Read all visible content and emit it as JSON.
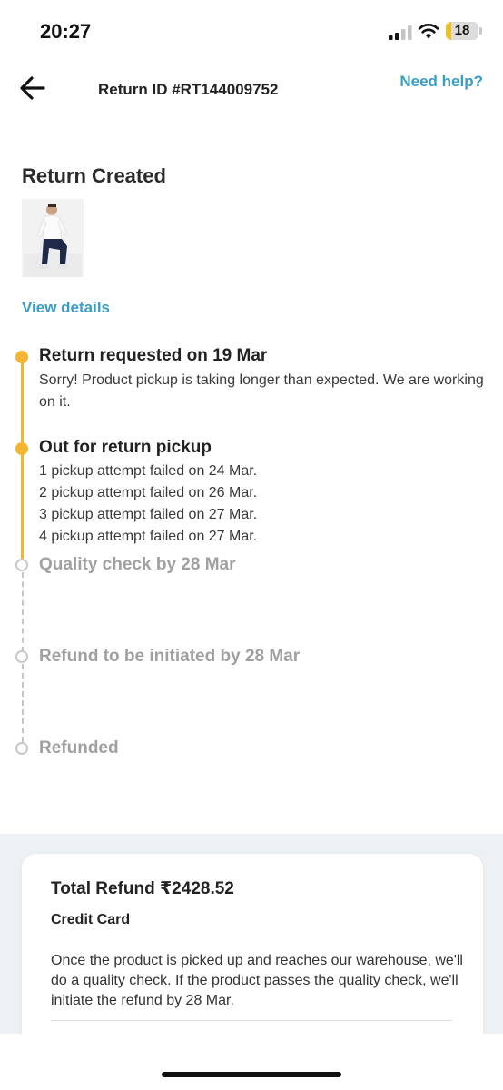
{
  "status_bar": {
    "time": "20:27",
    "battery_level": "18",
    "battery_fraction": 0.18,
    "icons": [
      "cellular-signal-icon",
      "wifi-icon",
      "battery-icon"
    ]
  },
  "header": {
    "back_icon": "arrow-left-icon",
    "title": "Return ID #RT144009752",
    "help_label": "Need help?"
  },
  "return_status": {
    "title": "Return Created",
    "product_image": "product-thumbnail",
    "view_details_label": "View details"
  },
  "timeline": {
    "steps": [
      {
        "title": "Return requested on 19 Mar",
        "description": "Sorry! Product pickup is taking longer than expected. We are working on it.",
        "state": "completed"
      },
      {
        "title": "Out for return pickup",
        "attempts": [
          "1 pickup attempt failed on 24 Mar.",
          "2 pickup attempt failed on 26 Mar.",
          "3 pickup attempt failed on 27 Mar.",
          "4 pickup attempt failed on 27 Mar."
        ],
        "state": "completed"
      },
      {
        "title": "Quality check by 28 Mar",
        "state": "pending"
      },
      {
        "title": "Refund to be initiated by 28 Mar",
        "state": "pending"
      },
      {
        "title": "Refunded",
        "state": "pending"
      }
    ]
  },
  "refund": {
    "total": "Total Refund ₹2428.52",
    "method": "Credit Card",
    "note": "Once the product is picked up and reaches our warehouse, we'll do a quality check. If the product passes the quality check, we'll initiate the refund by 28 Mar."
  },
  "colors": {
    "accent": "#3a9ec4",
    "timeline_active": "#f3b532",
    "timeline_pending": "#c6c6c6",
    "bottom_background": "#eef1f4"
  }
}
